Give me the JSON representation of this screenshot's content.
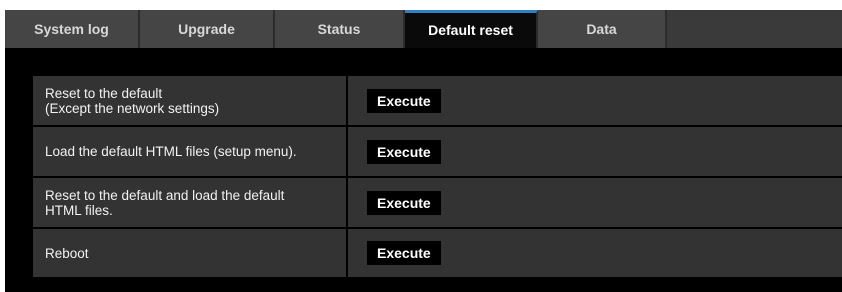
{
  "tabs": [
    {
      "label": "System log",
      "active": false
    },
    {
      "label": "Upgrade",
      "active": false
    },
    {
      "label": "Status",
      "active": false
    },
    {
      "label": "Default reset",
      "active": true
    },
    {
      "label": "Data",
      "active": false
    }
  ],
  "rows": [
    {
      "label": "Reset to the default\n(Except the network settings)",
      "button": "Execute"
    },
    {
      "label": "Load the default HTML files (setup menu).",
      "button": "Execute"
    },
    {
      "label": "Reset to the default and load the default\nHTML files.",
      "button": "Execute"
    },
    {
      "label": "Reboot",
      "button": "Execute"
    }
  ],
  "colors": {
    "active_tab_accent": "#2f7fc4",
    "tab_background": "#454545",
    "panel_background": "#000000",
    "row_background": "#333333"
  }
}
